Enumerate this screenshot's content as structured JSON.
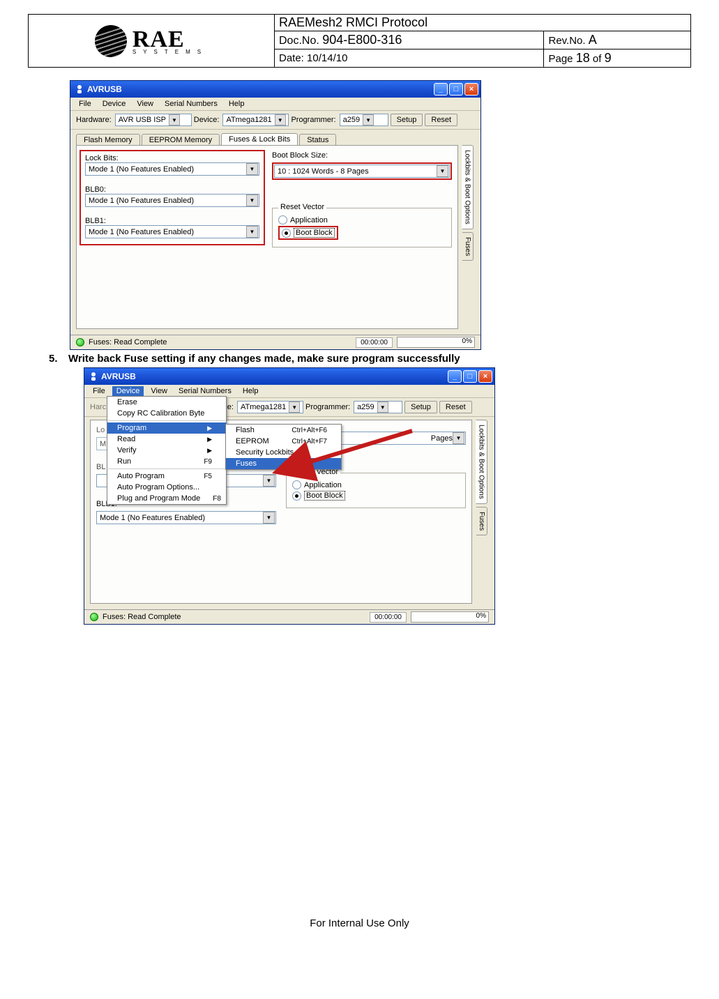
{
  "header": {
    "logo_main": "RAE",
    "logo_sub": "SYSTEMS",
    "title": "RAEMesh2 RMCI Protocol",
    "docno_label": "Doc.No.",
    "docno_value": "904-E800-316",
    "revno_label": "Rev.No.",
    "revno_value": "A",
    "date_label": "Date:",
    "date_value": "10/14/10",
    "page_label_a": "Page",
    "page_num": "18",
    "page_label_b": "of",
    "page_total": "9"
  },
  "step5": {
    "num": "5.",
    "text": "Write back Fuse setting if any changes made, make sure program successfully"
  },
  "app": {
    "title": "AVRUSB",
    "menus": [
      "File",
      "Device",
      "View",
      "Serial Numbers",
      "Help"
    ],
    "hw_label": "Hardware:",
    "hw_value": "AVR USB ISP",
    "dev_label": "Device:",
    "dev_value": "ATmega1281",
    "prog_label": "Programmer:",
    "prog_value": "a259",
    "setup_btn": "Setup",
    "reset_btn": "Reset",
    "tabs": [
      "Flash Memory",
      "EEPROM Memory",
      "Fuses & Lock Bits",
      "Status"
    ],
    "side_tabs": [
      "Lockbits & Boot Options",
      "Fuses"
    ],
    "lockbits_label": "Lock Bits:",
    "lockbits_value": "Mode 1 (No Features Enabled)",
    "blb0_label": "BLB0:",
    "blb0_value": "Mode 1 (No Features Enabled)",
    "blb1_label": "BLB1:",
    "blb1_value": "Mode 1 (No Features Enabled)",
    "bootblock_label": "Boot Block Size:",
    "bootblock_value": "10 : 1024 Words - 8 Pages",
    "bootblock_value_short": "Pages",
    "resetvec_label": "Reset Vector",
    "rv_app": "Application",
    "rv_boot": "Boot Block",
    "status_text": "Fuses: Read Complete",
    "status_time": "00:00:00",
    "status_pct": "0%"
  },
  "device_menu": {
    "items": [
      {
        "label": "Erase"
      },
      {
        "label": "Copy RC Calibration Byte"
      },
      {
        "sep": true
      },
      {
        "label": "Program",
        "sub": true,
        "hl": true
      },
      {
        "label": "Read",
        "sub": true
      },
      {
        "label": "Verify",
        "sub": true
      },
      {
        "label": "Run",
        "shortcut": "F9"
      },
      {
        "sep": true
      },
      {
        "label": "Auto Program",
        "shortcut": "F5"
      },
      {
        "label": "Auto Program Options..."
      },
      {
        "label": "Plug and Program Mode",
        "shortcut": "F8"
      }
    ],
    "submenu": [
      {
        "label": "Flash",
        "shortcut": "Ctrl+Alt+F6"
      },
      {
        "label": "EEPROM",
        "shortcut": "Ctrl+Alt+F7"
      },
      {
        "label": "Security Lockbits"
      },
      {
        "label": "Fuses",
        "hl": true
      }
    ]
  },
  "footer": "For Internal Use Only"
}
